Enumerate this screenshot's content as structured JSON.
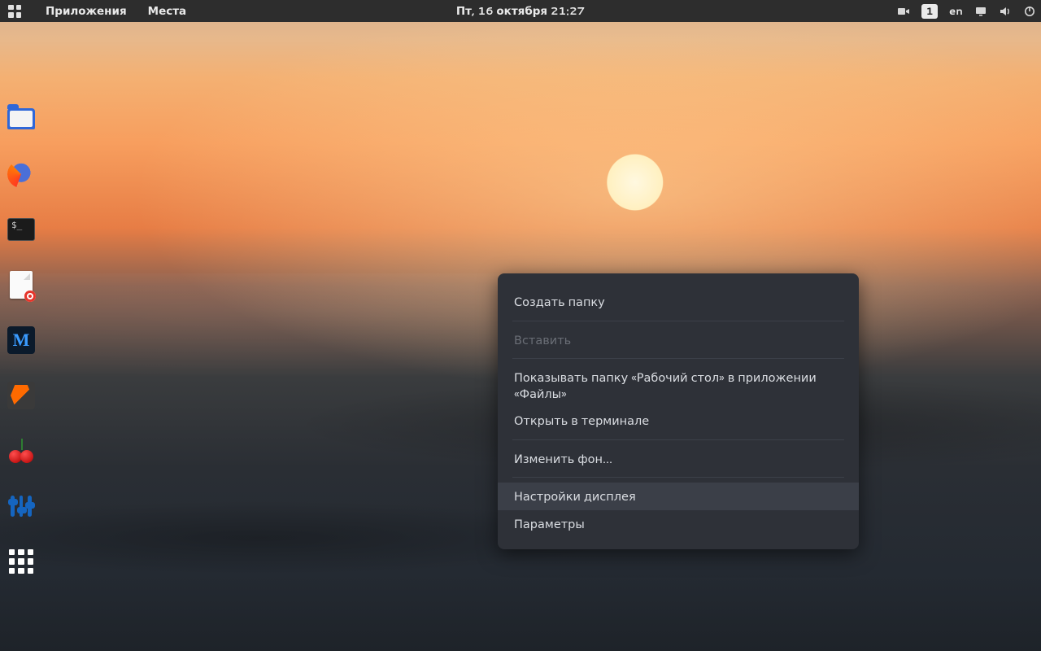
{
  "topbar": {
    "applications": "Приложения",
    "places": "Места",
    "clock": "Пт, 16 октября  21:27",
    "workspace": "1",
    "input_lang": "en"
  },
  "dock": {
    "files": "Файлы",
    "firefox": "Firefox",
    "terminal": "Терминал",
    "editor": "Текстовый редактор",
    "metasploit": "M",
    "burp": "Burp Suite",
    "cherry": "CherryTree",
    "tweaks": "Настройки",
    "show_apps": "Показать приложения"
  },
  "context_menu": {
    "new_folder": "Создать папку",
    "paste": "Вставить",
    "show_desktop_in_files": "Показывать папку «Рабочий стол» в приложении «Файлы»",
    "open_terminal": "Открыть в терминале",
    "change_background": "Изменить фон…",
    "display_settings": "Настройки дисплея",
    "settings": "Параметры"
  }
}
